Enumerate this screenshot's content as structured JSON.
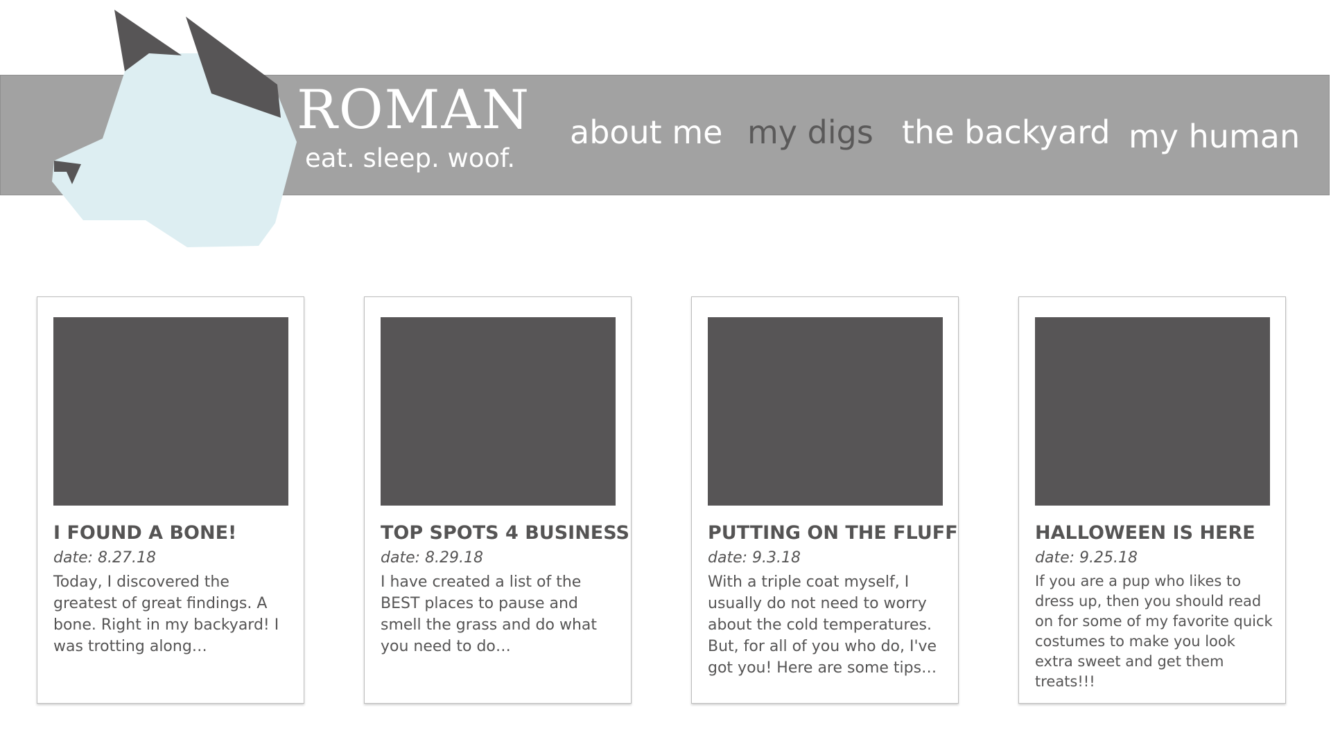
{
  "brand": {
    "name": "ROMAN",
    "tagline": "eat. sleep. woof."
  },
  "nav": {
    "items": [
      {
        "label": "about me"
      },
      {
        "label": "my digs"
      },
      {
        "label": "the backyard"
      },
      {
        "label": "my human"
      }
    ]
  },
  "colors": {
    "header_band": "#a2a2a2",
    "logo_face": "#ddeef2",
    "logo_ear": "#575556",
    "image_placeholder": "#575556",
    "text": "#555454",
    "nav_active": "#5a5959"
  },
  "icons": {
    "logo": "husky-head-icon"
  },
  "posts": [
    {
      "title": "I FOUND A BONE!",
      "date": "date: 8.27.18",
      "excerpt": "Today, I discovered the greatest of great findings. A bone. Right in my backyard! I was trotting along…"
    },
    {
      "title": "TOP SPOTS 4 BUSINESS",
      "date": "date: 8.29.18",
      "excerpt": "I have created a list of the BEST places to pause and smell the grass and do what you need to do…"
    },
    {
      "title": "PUTTING ON THE FLUFF",
      "date": "date: 9.3.18",
      "excerpt": "With a triple coat myself, I usually do not need to worry about the cold temperatures. But, for all of you who do, I've got you! Here are some tips…"
    },
    {
      "title": "HALLOWEEN IS HERE",
      "date": "date: 9.25.18",
      "excerpt": "If you are a pup who likes to dress up, then you should read on for some of my favorite quick costumes to make you look extra sweet and get them treats!!!"
    }
  ]
}
